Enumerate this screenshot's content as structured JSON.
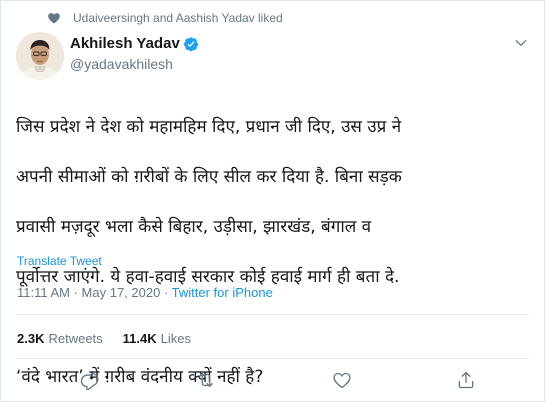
{
  "social_context": {
    "text": "Udaiveersingh and Aashish Yadav liked",
    "icon": "heart-icon"
  },
  "author": {
    "display_name": "Akhilesh Yadav",
    "handle": "@yadavakhilesh",
    "verified": true,
    "verified_icon": "verified-badge-icon"
  },
  "tweet": {
    "lines": [
      "जिस प्रदेश ने देश को महामहिम दिए, प्रधान जी दिए, उस उप्र ने",
      "अपनी सीमाओं को ग़रीबों के लिए सील कर दिया है. बिना सड़क",
      "प्रवासी मज़दूर भला कैसे बिहार, उड़ीसा, झारखंड, बंगाल व",
      "पूर्वोत्तर जाएंगे. ये हवा-हवाई सरकार कोई हवाई मार्ग ही बता दे.",
      "",
      "‘वंदे भारत’ में ग़रीब वंदनीय क्यों नहीं है?"
    ],
    "translate_label": "Translate Tweet",
    "time": "11:11 AM · May 17, 2020 ·",
    "source": "Twitter for iPhone"
  },
  "stats": {
    "retweets_count": "2.3K",
    "retweets_label": "Retweets",
    "likes_count": "11.4K",
    "likes_label": "Likes"
  },
  "actions": [
    "reply-icon",
    "retweet-icon",
    "like-icon",
    "share-icon"
  ],
  "colors": {
    "text": "#14171a",
    "muted": "#657786",
    "link": "#1b95e0",
    "divider": "#e6ecf0"
  }
}
